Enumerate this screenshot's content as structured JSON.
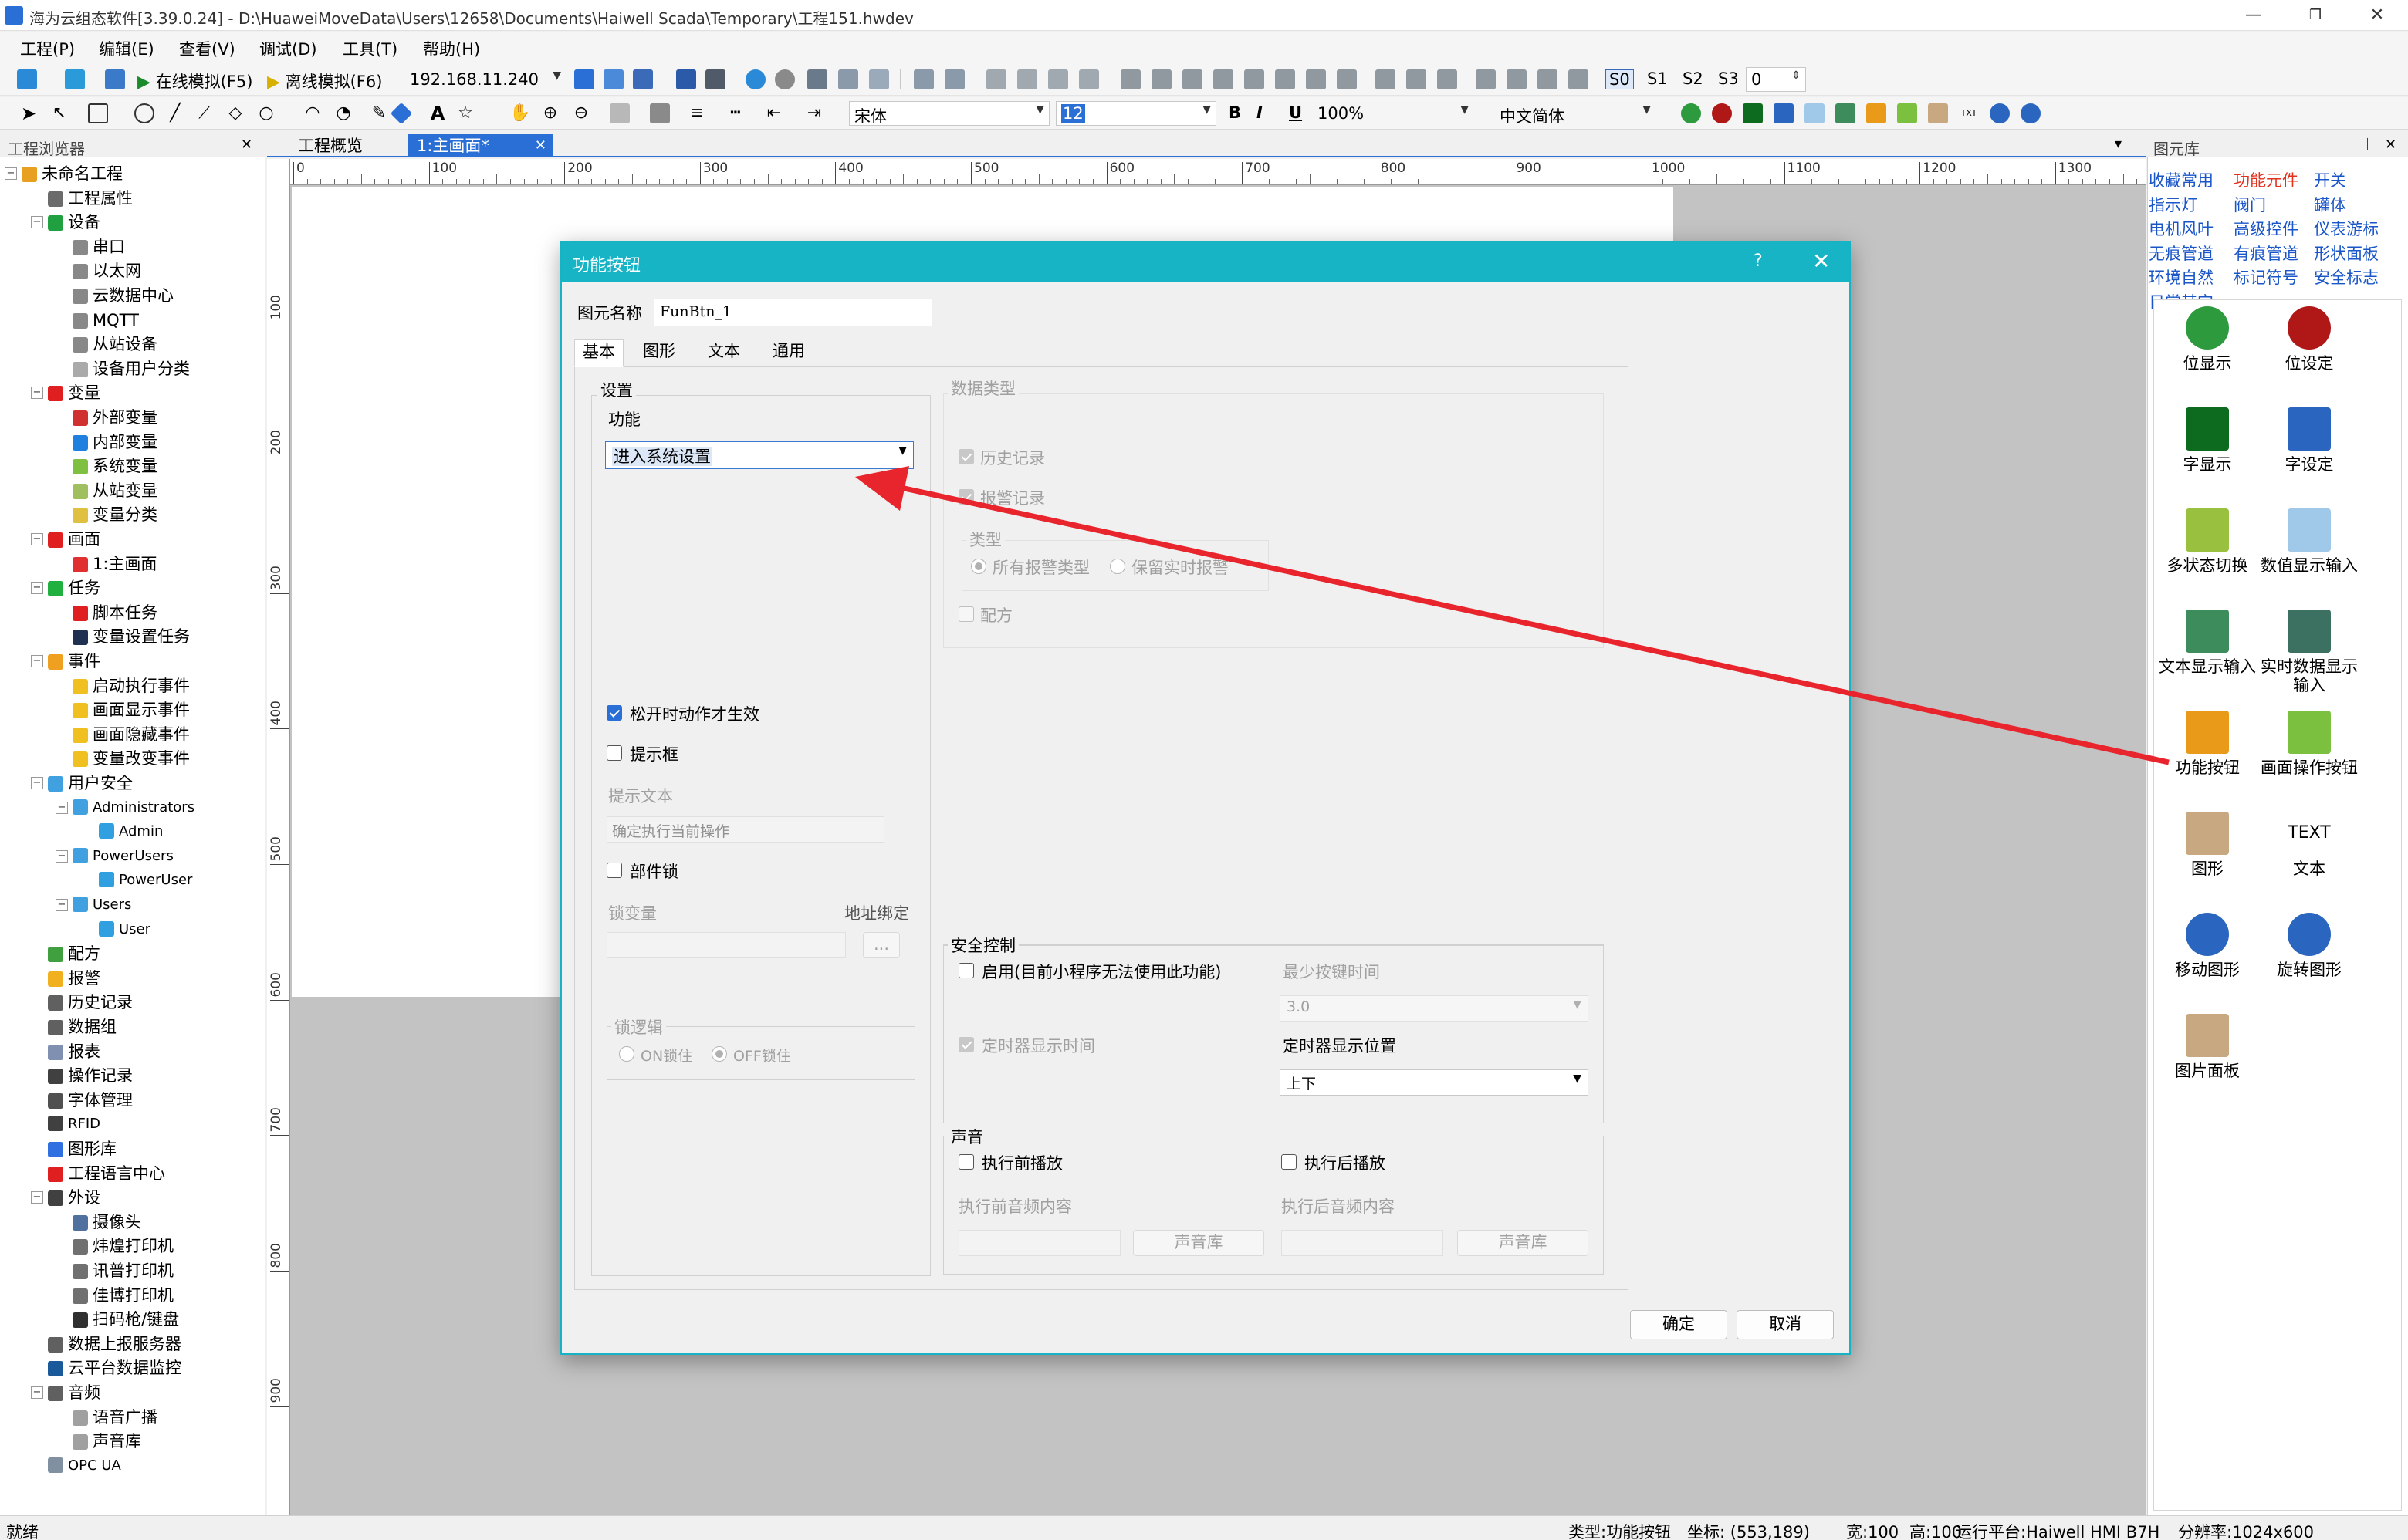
{
  "window": {
    "title": "海为云组态软件[3.39.0.24] - D:\\HuaweiMoveData\\Users\\12658\\Documents\\Haiwell Scada\\Temporary\\工程151.hwdev",
    "min_glyph": "—",
    "max_glyph": "❐",
    "close_glyph": "✕"
  },
  "menu": [
    "工程(P)",
    "编辑(E)",
    "查看(V)",
    "调试(D)",
    "工具(T)",
    "帮助(H)"
  ],
  "toolbar1": {
    "online_sim": "在线模拟(F5)",
    "offline_sim": "离线模拟(F6)",
    "ip": "192.168.11.240",
    "s0": "S0",
    "s1": "S1",
    "s2": "S2",
    "s3": "S3",
    "state_value": "0"
  },
  "toolbar2": {
    "font": "宋体",
    "size": "12",
    "bold": "B",
    "italic": "I",
    "underline": "U",
    "zoom": "100%",
    "language": "中文简体"
  },
  "left_panel": {
    "title": "工程浏览器",
    "pin": "ᛁ",
    "close": "✕",
    "tree": [
      {
        "label": "未命名工程",
        "level": 0,
        "toggle": "−",
        "color": "#e8a020"
      },
      {
        "label": "工程属性",
        "level": 1,
        "color": "#6b6b6b"
      },
      {
        "label": "设备",
        "level": 1,
        "toggle": "−",
        "color": "#20a040"
      },
      {
        "label": "串口",
        "level": 2,
        "color": "#888"
      },
      {
        "label": "以太网",
        "level": 2,
        "color": "#888"
      },
      {
        "label": "云数据中心",
        "level": 2,
        "color": "#888"
      },
      {
        "label": "MQTT",
        "level": 2,
        "color": "#888"
      },
      {
        "label": "从站设备",
        "level": 2,
        "color": "#888"
      },
      {
        "label": "设备用户分类",
        "level": 2,
        "color": "#aaa"
      },
      {
        "label": "变量",
        "level": 1,
        "toggle": "−",
        "color": "#e02020"
      },
      {
        "label": "外部变量",
        "level": 2,
        "color": "#d03030"
      },
      {
        "label": "内部变量",
        "level": 2,
        "color": "#2080e0"
      },
      {
        "label": "系统变量",
        "level": 2,
        "color": "#80c040"
      },
      {
        "label": "从站变量",
        "level": 2,
        "color": "#a0c060"
      },
      {
        "label": "变量分类",
        "level": 2,
        "color": "#e0c040"
      },
      {
        "label": "画面",
        "level": 1,
        "toggle": "−",
        "color": "#e02020"
      },
      {
        "label": "1:主画面",
        "level": 2,
        "color": "#e03030"
      },
      {
        "label": "任务",
        "level": 1,
        "toggle": "−",
        "color": "#20b040"
      },
      {
        "label": "脚本任务",
        "level": 2,
        "color": "#e02020"
      },
      {
        "label": "变量设置任务",
        "level": 2,
        "color": "#203050"
      },
      {
        "label": "事件",
        "level": 1,
        "toggle": "−",
        "color": "#f0a020"
      },
      {
        "label": "启动执行事件",
        "level": 2,
        "color": "#f0c020"
      },
      {
        "label": "画面显示事件",
        "level": 2,
        "color": "#f0c020"
      },
      {
        "label": "画面隐藏事件",
        "level": 2,
        "color": "#f0c020"
      },
      {
        "label": "变量改变事件",
        "level": 2,
        "color": "#f0c020"
      },
      {
        "label": "用户安全",
        "level": 1,
        "toggle": "−",
        "color": "#40a0e0"
      },
      {
        "label": "Administrators",
        "level": 2,
        "toggle": "−",
        "color": "#40a0e0",
        "small": true
      },
      {
        "label": "Admin",
        "level": 3,
        "color": "#30a0e0",
        "small": true
      },
      {
        "label": "PowerUsers",
        "level": 2,
        "toggle": "−",
        "color": "#40a0e0",
        "small": true
      },
      {
        "label": "PowerUser",
        "level": 3,
        "color": "#30a0e0",
        "small": true
      },
      {
        "label": "Users",
        "level": 2,
        "toggle": "−",
        "color": "#40a0e0",
        "small": true
      },
      {
        "label": "User",
        "level": 3,
        "color": "#30a0e0",
        "small": true
      },
      {
        "label": "配方",
        "level": 1,
        "color": "#40a040"
      },
      {
        "label": "报警",
        "level": 1,
        "color": "#f0b020"
      },
      {
        "label": "历史记录",
        "level": 1,
        "color": "#606060"
      },
      {
        "label": "数据组",
        "level": 1,
        "color": "#606060"
      },
      {
        "label": "报表",
        "level": 1,
        "color": "#8090b0"
      },
      {
        "label": "操作记录",
        "level": 1,
        "color": "#404040"
      },
      {
        "label": "字体管理",
        "level": 1,
        "color": "#505050"
      },
      {
        "label": "RFID",
        "level": 1,
        "color": "#404040",
        "small": true
      },
      {
        "label": "图形库",
        "level": 1,
        "color": "#3070e0"
      },
      {
        "label": "工程语言中心",
        "level": 1,
        "color": "#e02020"
      },
      {
        "label": "外设",
        "level": 1,
        "toggle": "−",
        "color": "#404040"
      },
      {
        "label": "摄像头",
        "level": 2,
        "color": "#5070a0"
      },
      {
        "label": "炜煌打印机",
        "level": 2,
        "color": "#707070"
      },
      {
        "label": "讯普打印机",
        "level": 2,
        "color": "#707070"
      },
      {
        "label": "佳博打印机",
        "level": 2,
        "color": "#707070"
      },
      {
        "label": "扫码枪/键盘",
        "level": 2,
        "color": "#303030"
      },
      {
        "label": "数据上报服务器",
        "level": 1,
        "color": "#606060"
      },
      {
        "label": "云平台数据监控",
        "level": 1,
        "color": "#1a5a9a"
      },
      {
        "label": "音频",
        "level": 1,
        "toggle": "−",
        "color": "#606060"
      },
      {
        "label": "语音广播",
        "level": 2,
        "color": "#a0a0a0"
      },
      {
        "label": "声音库",
        "level": 2,
        "color": "#a0a0a0"
      },
      {
        "label": "OPC UA",
        "level": 1,
        "color": "#8090a0",
        "small": true
      }
    ]
  },
  "doc_tabs": {
    "overview": "工程概览",
    "active": "1:主画面*",
    "close": "✕",
    "more": "▾"
  },
  "ruler": {
    "h_labels": [
      "0",
      "100",
      "200",
      "300",
      "400",
      "500",
      "600",
      "700",
      "800",
      "900",
      "1000",
      "1100",
      "1200",
      "1300"
    ],
    "v_labels": [
      "100",
      "200",
      "300",
      "400",
      "500",
      "600",
      "700",
      "800",
      "900"
    ]
  },
  "right_panel": {
    "title": "图元库",
    "categories": [
      {
        "label": "收藏常用",
        "active": false
      },
      {
        "label": "功能元件",
        "active": true
      },
      {
        "label": "开关",
        "active": false
      },
      {
        "label": "指示灯",
        "active": false
      },
      {
        "label": "阀门",
        "active": false
      },
      {
        "label": "罐体",
        "active": false
      },
      {
        "label": "电机风叶",
        "active": false
      },
      {
        "label": "高级控件",
        "active": false
      },
      {
        "label": "仪表游标",
        "active": false
      },
      {
        "label": "无痕管道",
        "active": false
      },
      {
        "label": "有痕管道",
        "active": false
      },
      {
        "label": "形状面板",
        "active": false
      },
      {
        "label": "环境自然",
        "active": false
      },
      {
        "label": "标记符号",
        "active": false
      },
      {
        "label": "安全标志",
        "active": false
      },
      {
        "label": "日常其它",
        "active": false
      }
    ],
    "components": [
      {
        "label": "位显示",
        "icon": "bit-display-icon",
        "color": "#2e9a3e"
      },
      {
        "label": "位设定",
        "icon": "bit-set-icon",
        "color": "#b01818"
      },
      {
        "label": "字显示",
        "icon": "word-display-icon",
        "color": "#0d6b1f"
      },
      {
        "label": "字设定",
        "icon": "word-set-icon",
        "color": "#2a66c0"
      },
      {
        "label": "多状态切换",
        "icon": "multi-state-switch-icon",
        "color": "#9ac040"
      },
      {
        "label": "数值显示输入",
        "icon": "numeric-io-icon",
        "color": "#a0c8e8"
      },
      {
        "label": "文本显示输入",
        "icon": "text-io-icon",
        "color": "#3c8c5c"
      },
      {
        "label": "实时数据显示输入",
        "icon": "realtime-data-icon",
        "color": "#3c7060"
      },
      {
        "label": "功能按钮",
        "icon": "function-button-icon",
        "color": "#e89a18"
      },
      {
        "label": "画面操作按钮",
        "icon": "screen-op-button-icon",
        "color": "#7cc040"
      },
      {
        "label": "图形",
        "icon": "picture-icon",
        "color": "#c8a880"
      },
      {
        "label": "文本",
        "icon": "text-icon",
        "color": "#ffffff",
        "glyph": "TEXT"
      },
      {
        "label": "移动图形",
        "icon": "move-shape-icon",
        "color": "#2a66c0"
      },
      {
        "label": "旋转图形",
        "icon": "rotate-shape-icon",
        "color": "#2a66c0"
      },
      {
        "label": "图片面板",
        "icon": "picture-panel-icon",
        "color": "#c8a880"
      }
    ]
  },
  "status_bar": {
    "ready": "就绪",
    "type": "类型:功能按钮",
    "coords": "坐标: (553,189)",
    "width": "宽:100",
    "height": "高:100",
    "platform": "运行平台:Haiwell HMI B7H",
    "resolution": "分辨率:1024x600"
  },
  "dialog": {
    "title": "功能按钮",
    "help": "?",
    "close": "✕",
    "name_label": "图元名称",
    "name_value": "FunBtn_1",
    "tabs": [
      "基本",
      "图形",
      "文本",
      "通用"
    ],
    "settings": {
      "group": "设置",
      "function_label": "功能",
      "function_value": "进入系统设置",
      "release_effective": "松开时动作才生效",
      "prompt_box": "提示框",
      "prompt_text_label": "提示文本",
      "prompt_text_value": "确定执行当前操作",
      "component_lock": "部件锁",
      "lock_var_label": "锁变量",
      "addr_bind_label": "地址绑定",
      "addr_bind_btn": "...",
      "lock_logic_group": "锁逻辑",
      "on_lock": "ON锁住",
      "off_lock": "OFF锁住"
    },
    "datatype": {
      "group": "数据类型",
      "history": "历史记录",
      "alarm": "报警记录",
      "type_group": "类型",
      "all_alarm_types": "所有报警类型",
      "keep_realtime": "保留实时报警",
      "recipe": "配方"
    },
    "security": {
      "group": "安全控制",
      "enable": "启用(目前小程序无法使用此功能)",
      "min_press_label": "最少按键时间",
      "min_press_value": "3.0",
      "timer_show": "定时器显示时间",
      "timer_pos_label": "定时器显示位置",
      "timer_pos_value": "上下"
    },
    "sound": {
      "group": "声音",
      "before": "执行前播放",
      "after": "执行后播放",
      "before_content": "执行前音频内容",
      "after_content": "执行后音频内容",
      "library": "声音库"
    },
    "ok": "确定",
    "cancel": "取消"
  },
  "colors": {
    "dialog_title": "#17b4c6",
    "arrow": "#e8242c",
    "link": "#1a56c8",
    "active_link": "#e2321e"
  }
}
